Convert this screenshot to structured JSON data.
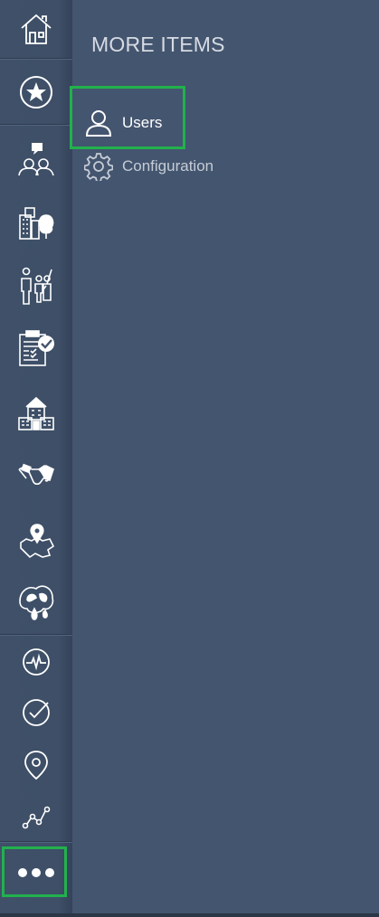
{
  "panel": {
    "title": "MORE ITEMS",
    "items": [
      {
        "label": "Users",
        "icon": "user-icon",
        "selected": true
      },
      {
        "label": "Configuration",
        "icon": "gear-icon",
        "selected": false
      }
    ]
  },
  "rail": {
    "items": [
      {
        "icon": "home-icon"
      },
      {
        "icon": "star-icon"
      },
      {
        "icon": "people-chat-icon"
      },
      {
        "icon": "city-tree-icon"
      },
      {
        "icon": "family-icon"
      },
      {
        "icon": "checklist-icon"
      },
      {
        "icon": "housing-icon"
      },
      {
        "icon": "handshake-icon"
      },
      {
        "icon": "map-pin-icon"
      },
      {
        "icon": "environment-icon"
      },
      {
        "icon": "activity-icon"
      },
      {
        "icon": "check-circle-icon"
      },
      {
        "icon": "location-icon"
      },
      {
        "icon": "trend-line-icon"
      },
      {
        "icon": "more-icon"
      }
    ]
  },
  "colors": {
    "highlight": "#22b14c",
    "background": "#44556f",
    "icon": "#ffffff"
  }
}
